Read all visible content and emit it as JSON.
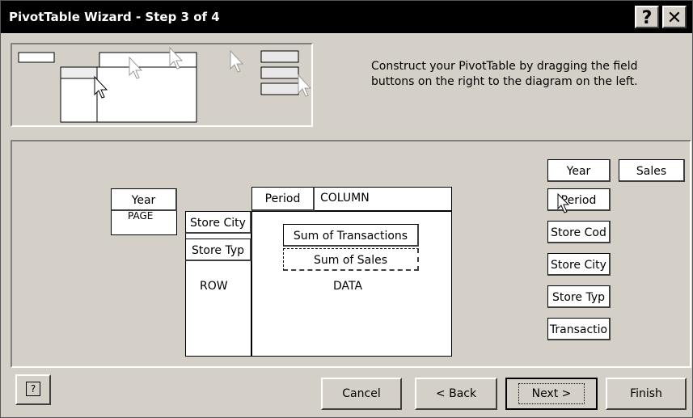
{
  "window": {
    "title": "PivotTable Wizard - Step 3 of 4",
    "help_glyph": "?",
    "close_glyph": "✕"
  },
  "instruction": "Construct your PivotTable by dragging the field buttons on the right to the diagram on the left.",
  "layout": {
    "page_field": "Year",
    "page_label": "PAGE",
    "column_field": "Period",
    "column_label": "COLUMN",
    "row_fields": [
      "Store City",
      "Store Typ"
    ],
    "row_label": "ROW",
    "data_fields": [
      "Sum of Transactions",
      "Sum of Sales"
    ],
    "data_label": "DATA"
  },
  "field_list": [
    "Year",
    "Sales",
    "Period",
    "Store Cod",
    "Store City",
    "Store Typ",
    "Transactio"
  ],
  "footer": {
    "help_icon": "?",
    "cancel": "Cancel",
    "back": "< Back",
    "next": "Next >",
    "finish": "Finish"
  }
}
